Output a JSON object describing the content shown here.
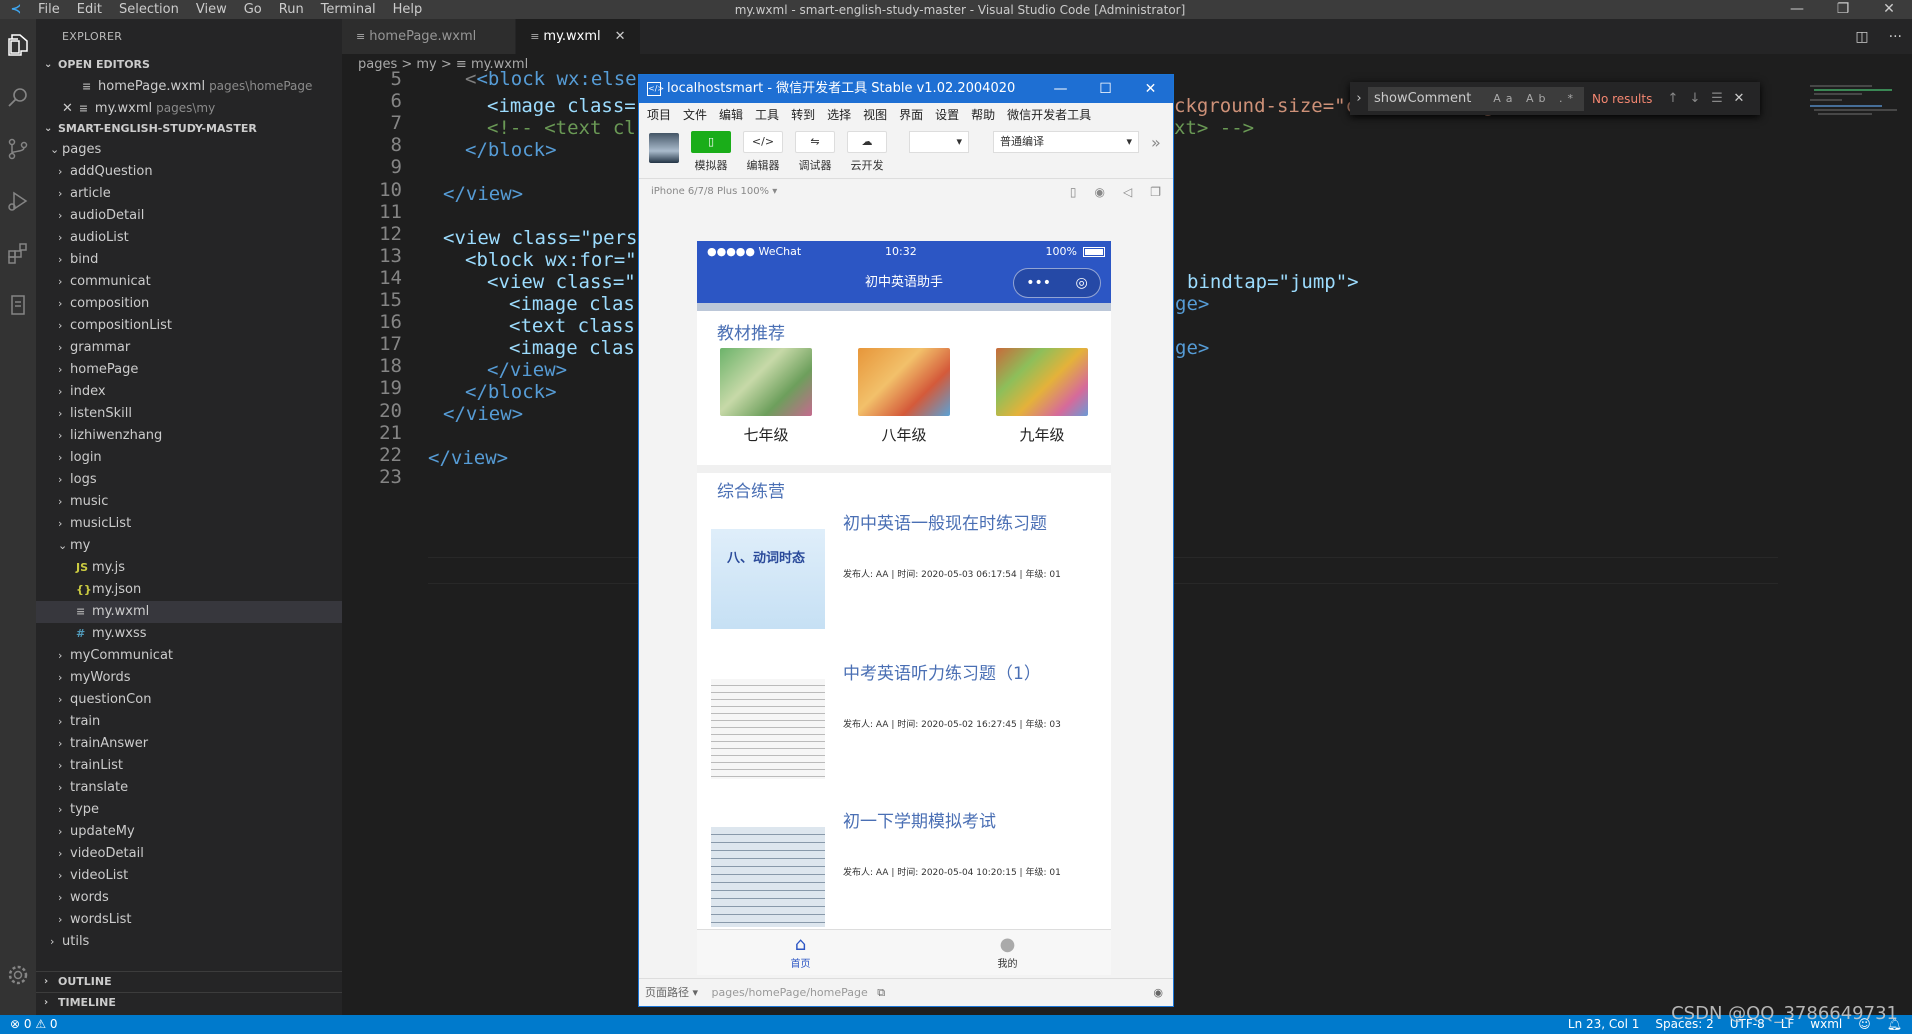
{
  "titlebar": {
    "menu": [
      "File",
      "Edit",
      "Selection",
      "View",
      "Go",
      "Run",
      "Terminal",
      "Help"
    ],
    "title": "my.wxml - smart-english-study-master - Visual Studio Code [Administrator]"
  },
  "sidebar": {
    "header": "EXPLORER",
    "open_editors_label": "OPEN EDITORS",
    "open_editors": [
      {
        "name": "homePage.wxml",
        "path": "pages\\homePage"
      },
      {
        "name": "my.wxml",
        "path": "pages\\my"
      }
    ],
    "project_label": "SMART-ENGLISH-STUDY-MASTER",
    "pages_label": "pages",
    "folders_before": [
      "addQuestion",
      "article",
      "audioDetail",
      "audioList",
      "bind",
      "communicat",
      "composition",
      "compositionList",
      "grammar",
      "homePage",
      "index",
      "listenSkill",
      "lizhiwenzhang",
      "login",
      "logs",
      "music",
      "musicList"
    ],
    "my_folder": "my",
    "my_files": [
      {
        "icon": "JS",
        "name": "my.js"
      },
      {
        "icon": "{}",
        "name": "my.json"
      },
      {
        "icon": "≡",
        "name": "my.wxml"
      },
      {
        "icon": "#",
        "name": "my.wxss"
      }
    ],
    "folders_after": [
      "myCommunicat",
      "myWords",
      "questionCon",
      "train",
      "trainAnswer",
      "trainList",
      "translate",
      "type",
      "updateMy",
      "videoDetail",
      "videoList",
      "words",
      "wordsList"
    ],
    "utils": "utils",
    "outline": "OUTLINE",
    "timeline": "TIMELINE"
  },
  "tabs": [
    {
      "label": "homePage.wxml"
    },
    {
      "label": "my.wxml"
    }
  ],
  "breadcrumb": "pages > my > ≡ my.wxml",
  "code": {
    "line_numbers": [
      "5",
      "6",
      "7",
      "8",
      "9",
      "10",
      "11",
      "12",
      "13",
      "14",
      "15",
      "16",
      "17",
      "18",
      "19",
      "20",
      "21",
      "22",
      "23"
    ],
    "visible_fragments": {
      "l5": "<block wx:else",
      "l6a": "<image class=",
      "l6b": "ckground-size=\"cover\"></image>",
      "l7a": "<!-- <text cl",
      "l7b": "xt> -->",
      "l8": "</block>",
      "l10": "</view>",
      "l12": "<view class=\"pers",
      "l13": "<block wx:for=\"",
      "l14a": "<view class=\"",
      "l14b": "bindtap=\"jump\">",
      "l15a": "<image clas",
      "l15b": "ge>",
      "l16": "<text class",
      "l17a": "<image clas",
      "l17b": "ge>",
      "l18": "</view>",
      "l19": "</block>",
      "l20": "</view>",
      "l22": "</view>"
    }
  },
  "find": {
    "query": "showComment",
    "options": "Aa Ab .*",
    "result": "No results"
  },
  "statusbar": {
    "left": "⊗ 0 ⚠ 0",
    "ln_col": "Ln 23, Col 1",
    "spaces": "Spaces: 2",
    "encoding": "UTF-8",
    "eol": "LF",
    "language": "wxml"
  },
  "watermark": "CSDN @QQ_3786649731",
  "wx": {
    "title": "localhostsmart - 微信开发者工具 Stable v1.02.2004020",
    "menu": [
      "项目",
      "文件",
      "编辑",
      "工具",
      "转到",
      "选择",
      "视图",
      "界面",
      "设置",
      "帮助",
      "微信开发者工具"
    ],
    "tools": [
      "模拟器",
      "编辑器",
      "调试器",
      "云开发"
    ],
    "compile_mode": "普通编译",
    "device": "iPhone 6/7/8 Plus 100% ▾",
    "page_path_label": "页面路径 ▾",
    "page_path": "pages/homePage/homePage",
    "phone": {
      "carrier": "●●●●● WeChat",
      "time": "10:32",
      "battery": "100%",
      "nav_title": "初中英语助手",
      "textbook_title": "教材推荐",
      "books": [
        "七年级",
        "八年级",
        "九年级"
      ],
      "practice_title": "综合练营",
      "exercises": [
        {
          "title": "初中英语一般现在时练习题",
          "meta": "发布人: AA | 时间: 2020-05-03 06:17:54 | 年级: 01"
        },
        {
          "title": "中考英语听力练习题（1）",
          "meta": "发布人: AA | 时间: 2020-05-02 16:27:45 | 年级: 03"
        },
        {
          "title": "初一下学期模拟考试",
          "meta": "发布人: AA | 时间: 2020-05-04 10:20:15 | 年级: 01"
        }
      ],
      "thumb_text": "八、动词时态",
      "tab_home": "首页",
      "tab_my": "我的"
    }
  }
}
